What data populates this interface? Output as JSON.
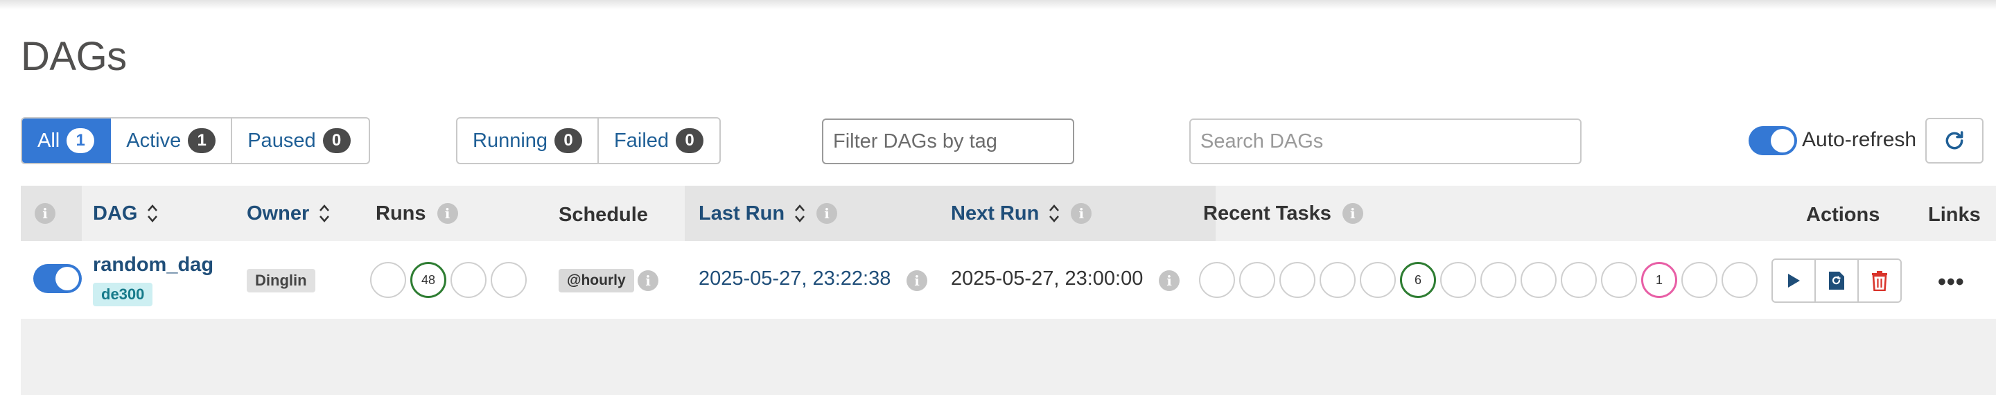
{
  "page": {
    "title": "DAGs"
  },
  "filters": {
    "status_tabs": [
      {
        "label": "All",
        "count": "1"
      },
      {
        "label": "Active",
        "count": "1"
      },
      {
        "label": "Paused",
        "count": "0"
      }
    ],
    "run_tabs": [
      {
        "label": "Running",
        "count": "0"
      },
      {
        "label": "Failed",
        "count": "0"
      }
    ],
    "tag_placeholder": "Filter DAGs by tag",
    "search_placeholder": "Search DAGs",
    "auto_refresh_label": "Auto-refresh",
    "auto_refresh_on": true
  },
  "table": {
    "headers": {
      "dag": "DAG",
      "owner": "Owner",
      "runs": "Runs",
      "schedule": "Schedule",
      "last_run": "Last Run",
      "next_run": "Next Run",
      "recent_tasks": "Recent Tasks",
      "actions": "Actions",
      "links": "Links"
    },
    "rows": [
      {
        "enabled": true,
        "dag_id": "random_dag",
        "tag": "de300",
        "owner": "Dinglin",
        "runs": [
          "",
          "48",
          "",
          ""
        ],
        "schedule": "@hourly",
        "last_run": "2025-05-27, 23:22:38",
        "next_run": "2025-05-27, 23:00:00",
        "recent_tasks": [
          "",
          "",
          "",
          "",
          "",
          "6",
          "",
          "",
          "",
          "",
          "",
          "1",
          "",
          ""
        ]
      }
    ]
  },
  "colors": {
    "primary": "#3478d4",
    "link": "#1f4e79",
    "success": "#2e7d32",
    "queued": "#e85fa6",
    "delete": "#d9342b"
  },
  "icons": {
    "info": "info-icon",
    "sort": "sort-icon",
    "refresh": "refresh-icon",
    "trigger": "play-icon",
    "clear": "refresh-file-icon",
    "delete": "trash-icon",
    "links": "more-horizontal-icon"
  }
}
